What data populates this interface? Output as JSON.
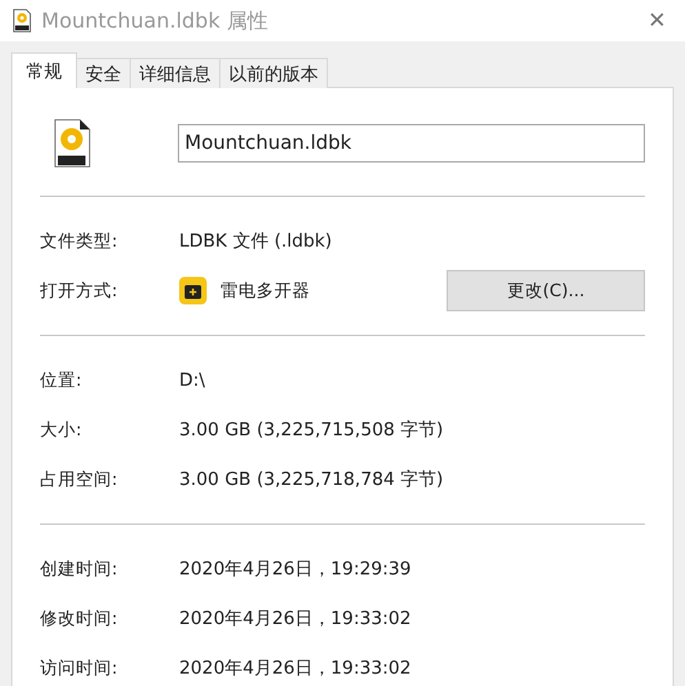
{
  "window": {
    "title": "Mountchuan.ldbk 属性",
    "close": "✕"
  },
  "tabs": [
    {
      "label": "常规",
      "selected": true
    },
    {
      "label": "安全",
      "selected": false
    },
    {
      "label": "详细信息",
      "selected": false
    },
    {
      "label": "以前的版本",
      "selected": false
    }
  ],
  "file_name": {
    "value": "Mountchuan.ldbk"
  },
  "sections": [
    [
      {
        "kind": "text",
        "label": "文件类型:",
        "value": "LDBK 文件 (.ldbk)"
      },
      {
        "kind": "app",
        "label": "打开方式:",
        "value": "雷电多开器",
        "button": "更改(C)..."
      }
    ],
    [
      {
        "kind": "text",
        "label": "位置:",
        "value": "D:\\"
      },
      {
        "kind": "text",
        "label": "大小:",
        "value": "3.00 GB (3,225,715,508 字节)"
      },
      {
        "kind": "text",
        "label": "占用空间:",
        "value": "3.00 GB (3,225,718,784 字节)"
      }
    ],
    [
      {
        "kind": "text",
        "label": "创建时间:",
        "value": "2020年4月26日，19:29:39"
      },
      {
        "kind": "text",
        "label": "修改时间:",
        "value": "2020年4月26日，19:33:02"
      },
      {
        "kind": "text",
        "label": "访问时间:",
        "value": "2020年4月26日，19:33:02"
      }
    ]
  ]
}
